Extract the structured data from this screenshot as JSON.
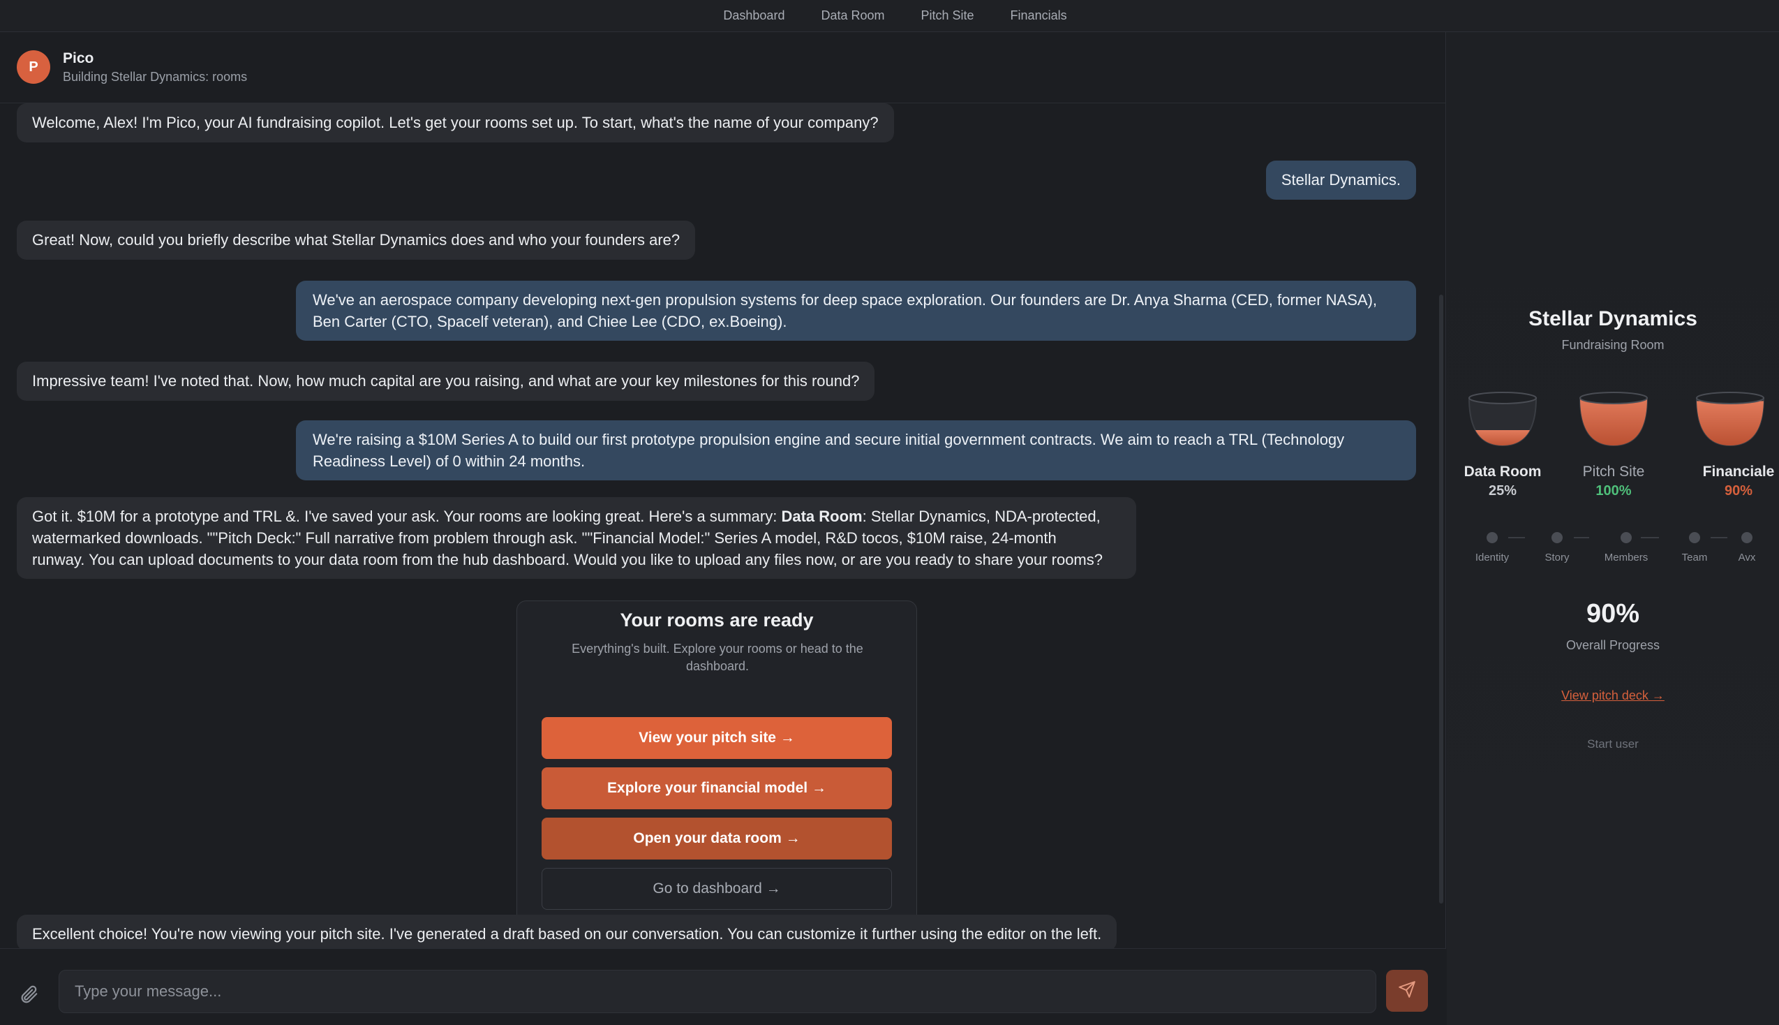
{
  "nav": {
    "items": [
      "Dashboard",
      "Data Room",
      "Pitch Site",
      "Financials"
    ]
  },
  "chat_header": {
    "avatar_initial": "P",
    "name": "Pico",
    "status": "Building Stellar Dynamics: rooms"
  },
  "messages": [
    {
      "role": "bot",
      "text": "Welcome, Alex! I'm Pico, your AI fundraising copilot. Let's get your rooms set up. To start, what's the name of your company?"
    },
    {
      "role": "user",
      "text": "Stellar Dynamics."
    },
    {
      "role": "bot",
      "text": "Great! Now, could you briefly describe what Stellar Dynamics does and who your founders are?"
    },
    {
      "role": "user",
      "line1": "We've an aerospace company developing next-gen propulsion systems for deep space exploration. Our founders are Dr. Anya Sharma (CED, former NASA),",
      "line2": "Ben Carter (CTO, Spacelf veteran), and Chiee Lee (CDO, ex.Boeing)."
    },
    {
      "role": "bot",
      "text": "Impressive team! I've noted that. Now, how much capital are you raising, and what are your key milestones for this round?"
    },
    {
      "role": "user",
      "line1": "We're raising a $10M Series A to build our first prototype propulsion engine and secure initial government contracts. We aim to reach a TRL (Technology",
      "line2": "Readiness Level) of 0 within 24 months."
    },
    {
      "role": "bot",
      "line1_a": "Got it. $10M for a prototype and TRL &. I've saved your ask. Your rooms are looking great. Here's a summary: ",
      "line1_bold": "Data Room",
      "line1_b": ": Stellar Dynamics, NDA-protected,",
      "line2": "watermarked downloads. \"\"Pitch Deck:\" Full narrative from problem through ask. \"\"Financial Model:\" Series A model, R&D tocos, $10M raise, 24-month",
      "line3": "runway. You can upload documents to your data room from the hub dashboard. Would you like to upload any files now, or are you ready to share your rooms?"
    },
    {
      "role": "bot",
      "text": "Excellent choice! You're now viewing your pitch site. I've generated a draft based on our conversation. You can customize it further using the editor on the left."
    }
  ],
  "ready_card": {
    "title": "Your rooms are ready",
    "subtitle": "Everything's built. Explore your rooms or head to the dashboard.",
    "buttons": [
      "View your pitch site →",
      "Explore your financial model →",
      "Open your data room →",
      "Go to dashboard →"
    ]
  },
  "composer": {
    "placeholder": "Type your message..."
  },
  "side": {
    "title": "Stellar Dynamics",
    "subtitle": "Fundraising Room",
    "rooms": [
      {
        "label": "Data Room",
        "pct": "25%",
        "fill": 0.25,
        "pct_color": "#c9ccd1"
      },
      {
        "label": "Pitch Site",
        "pct": "100%",
        "fill": 1.0,
        "pct_color": "#4fbf7a"
      },
      {
        "label": "Financiale",
        "pct": "90%",
        "fill": 0.9,
        "pct_color": "#d6603c"
      }
    ],
    "steps": [
      "Identity",
      "Story",
      "Members",
      "Team",
      "Avx"
    ],
    "overall_value": "90%",
    "overall_label": "Overall Progress",
    "deck_link": "View pitch deck →",
    "start_user": "Start user"
  },
  "colors": {
    "accent": "#dd623a",
    "user_bubble": "#34485f",
    "bot_bubble": "#2a2c31"
  }
}
